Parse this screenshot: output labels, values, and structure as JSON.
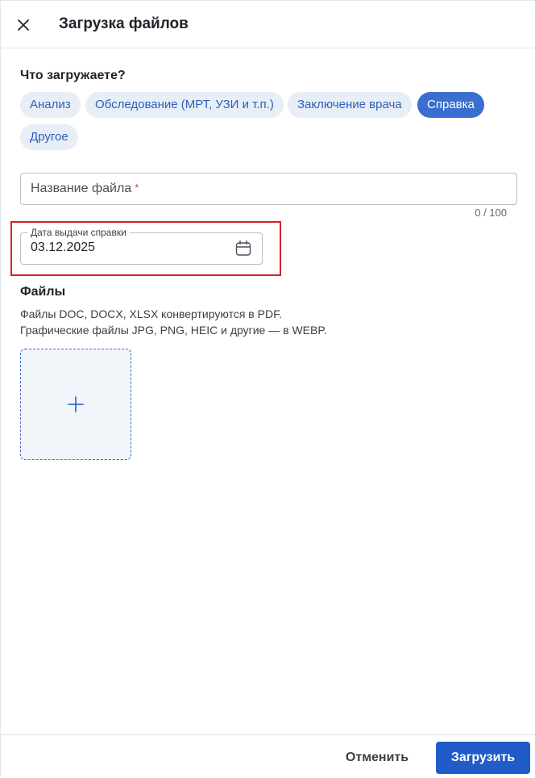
{
  "header": {
    "title": "Загрузка файлов",
    "close_icon": "close-icon"
  },
  "category": {
    "question": "Что загружаете?",
    "options": [
      {
        "label": "Анализ",
        "selected": false
      },
      {
        "label": "Обследование (МРТ, УЗИ и т.п.)",
        "selected": false
      },
      {
        "label": "Заключение врача",
        "selected": false
      },
      {
        "label": "Справка",
        "selected": true
      },
      {
        "label": "Другое",
        "selected": false
      }
    ]
  },
  "file_name": {
    "placeholder": "Название файла",
    "required_mark": "*",
    "value": "",
    "counter": "0 / 100"
  },
  "issue_date": {
    "label": "Дата выдачи справки",
    "value": "03.12.2025",
    "icon": "calendar-icon"
  },
  "files": {
    "title": "Файлы",
    "desc_line1": "Файлы DOC, DOCX, XLSX конвертируются в PDF.",
    "desc_line2": "Графические файлы JPG, PNG, HEIC и другие — в WEBP.",
    "add_icon": "plus-icon"
  },
  "footer": {
    "cancel_label": "Отменить",
    "upload_label": "Загрузить"
  },
  "colors": {
    "accent": "#1f5cc8",
    "chip_bg": "#e8eef6",
    "chip_text": "#2b5fb8",
    "chip_active_bg": "#3a6fd0",
    "highlight": "#d61f26",
    "required": "#d23c3c"
  }
}
